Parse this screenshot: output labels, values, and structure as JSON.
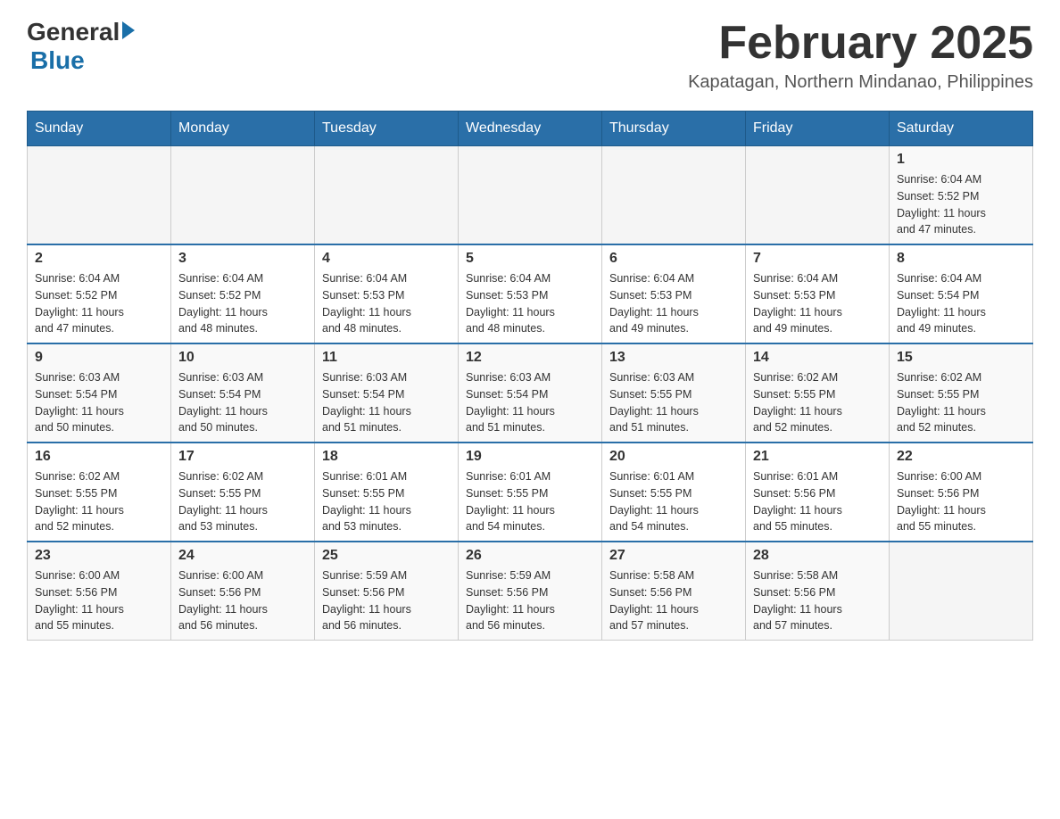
{
  "logo": {
    "general": "General",
    "blue": "Blue"
  },
  "title": {
    "month_year": "February 2025",
    "location": "Kapatagan, Northern Mindanao, Philippines"
  },
  "weekdays": [
    "Sunday",
    "Monday",
    "Tuesday",
    "Wednesday",
    "Thursday",
    "Friday",
    "Saturday"
  ],
  "weeks": [
    {
      "days": [
        {
          "number": "",
          "info": ""
        },
        {
          "number": "",
          "info": ""
        },
        {
          "number": "",
          "info": ""
        },
        {
          "number": "",
          "info": ""
        },
        {
          "number": "",
          "info": ""
        },
        {
          "number": "",
          "info": ""
        },
        {
          "number": "1",
          "info": "Sunrise: 6:04 AM\nSunset: 5:52 PM\nDaylight: 11 hours\nand 47 minutes."
        }
      ]
    },
    {
      "days": [
        {
          "number": "2",
          "info": "Sunrise: 6:04 AM\nSunset: 5:52 PM\nDaylight: 11 hours\nand 47 minutes."
        },
        {
          "number": "3",
          "info": "Sunrise: 6:04 AM\nSunset: 5:52 PM\nDaylight: 11 hours\nand 48 minutes."
        },
        {
          "number": "4",
          "info": "Sunrise: 6:04 AM\nSunset: 5:53 PM\nDaylight: 11 hours\nand 48 minutes."
        },
        {
          "number": "5",
          "info": "Sunrise: 6:04 AM\nSunset: 5:53 PM\nDaylight: 11 hours\nand 48 minutes."
        },
        {
          "number": "6",
          "info": "Sunrise: 6:04 AM\nSunset: 5:53 PM\nDaylight: 11 hours\nand 49 minutes."
        },
        {
          "number": "7",
          "info": "Sunrise: 6:04 AM\nSunset: 5:53 PM\nDaylight: 11 hours\nand 49 minutes."
        },
        {
          "number": "8",
          "info": "Sunrise: 6:04 AM\nSunset: 5:54 PM\nDaylight: 11 hours\nand 49 minutes."
        }
      ]
    },
    {
      "days": [
        {
          "number": "9",
          "info": "Sunrise: 6:03 AM\nSunset: 5:54 PM\nDaylight: 11 hours\nand 50 minutes."
        },
        {
          "number": "10",
          "info": "Sunrise: 6:03 AM\nSunset: 5:54 PM\nDaylight: 11 hours\nand 50 minutes."
        },
        {
          "number": "11",
          "info": "Sunrise: 6:03 AM\nSunset: 5:54 PM\nDaylight: 11 hours\nand 51 minutes."
        },
        {
          "number": "12",
          "info": "Sunrise: 6:03 AM\nSunset: 5:54 PM\nDaylight: 11 hours\nand 51 minutes."
        },
        {
          "number": "13",
          "info": "Sunrise: 6:03 AM\nSunset: 5:55 PM\nDaylight: 11 hours\nand 51 minutes."
        },
        {
          "number": "14",
          "info": "Sunrise: 6:02 AM\nSunset: 5:55 PM\nDaylight: 11 hours\nand 52 minutes."
        },
        {
          "number": "15",
          "info": "Sunrise: 6:02 AM\nSunset: 5:55 PM\nDaylight: 11 hours\nand 52 minutes."
        }
      ]
    },
    {
      "days": [
        {
          "number": "16",
          "info": "Sunrise: 6:02 AM\nSunset: 5:55 PM\nDaylight: 11 hours\nand 52 minutes."
        },
        {
          "number": "17",
          "info": "Sunrise: 6:02 AM\nSunset: 5:55 PM\nDaylight: 11 hours\nand 53 minutes."
        },
        {
          "number": "18",
          "info": "Sunrise: 6:01 AM\nSunset: 5:55 PM\nDaylight: 11 hours\nand 53 minutes."
        },
        {
          "number": "19",
          "info": "Sunrise: 6:01 AM\nSunset: 5:55 PM\nDaylight: 11 hours\nand 54 minutes."
        },
        {
          "number": "20",
          "info": "Sunrise: 6:01 AM\nSunset: 5:55 PM\nDaylight: 11 hours\nand 54 minutes."
        },
        {
          "number": "21",
          "info": "Sunrise: 6:01 AM\nSunset: 5:56 PM\nDaylight: 11 hours\nand 55 minutes."
        },
        {
          "number": "22",
          "info": "Sunrise: 6:00 AM\nSunset: 5:56 PM\nDaylight: 11 hours\nand 55 minutes."
        }
      ]
    },
    {
      "days": [
        {
          "number": "23",
          "info": "Sunrise: 6:00 AM\nSunset: 5:56 PM\nDaylight: 11 hours\nand 55 minutes."
        },
        {
          "number": "24",
          "info": "Sunrise: 6:00 AM\nSunset: 5:56 PM\nDaylight: 11 hours\nand 56 minutes."
        },
        {
          "number": "25",
          "info": "Sunrise: 5:59 AM\nSunset: 5:56 PM\nDaylight: 11 hours\nand 56 minutes."
        },
        {
          "number": "26",
          "info": "Sunrise: 5:59 AM\nSunset: 5:56 PM\nDaylight: 11 hours\nand 56 minutes."
        },
        {
          "number": "27",
          "info": "Sunrise: 5:58 AM\nSunset: 5:56 PM\nDaylight: 11 hours\nand 57 minutes."
        },
        {
          "number": "28",
          "info": "Sunrise: 5:58 AM\nSunset: 5:56 PM\nDaylight: 11 hours\nand 57 minutes."
        },
        {
          "number": "",
          "info": ""
        }
      ]
    }
  ]
}
